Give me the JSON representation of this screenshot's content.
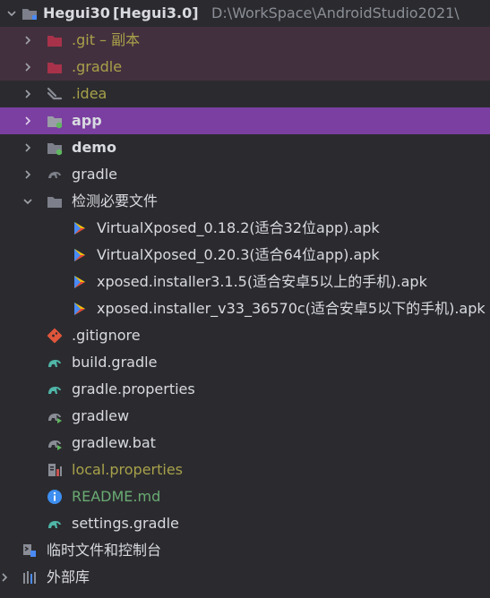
{
  "project": {
    "name": "Hegui30",
    "module": "[Hegui3.0]",
    "path": "D:\\WorkSpace\\AndroidStudio2021\\"
  },
  "items": [
    {
      "label": ".git – 副本",
      "icon": "folder-icon",
      "state": "ignored"
    },
    {
      "label": ".gradle",
      "icon": "folder-icon",
      "state": "ignored"
    },
    {
      "label": ".idea",
      "icon": "idea-folder-icon"
    },
    {
      "label": "app",
      "icon": "module-folder-icon",
      "state": "selected"
    },
    {
      "label": "demo",
      "icon": "module-folder-icon"
    },
    {
      "label": "gradle",
      "icon": "gradle-folder-icon"
    },
    {
      "label": "检测必要文件",
      "icon": "folder-icon",
      "state": "expanded"
    },
    {
      "label": "VirtualXposed_0.18.2(适合32位app).apk",
      "icon": "apk-icon"
    },
    {
      "label": "VirtualXposed_0.20.3(适合64位app).apk",
      "icon": "apk-icon"
    },
    {
      "label": "xposed.installer3.1.5(适合安卓5以上的手机).apk",
      "icon": "apk-icon"
    },
    {
      "label": "xposed.installer_v33_36570c(适合安卓5以下的手机).apk",
      "icon": "apk-icon"
    },
    {
      "label": ".gitignore",
      "icon": "gitignore-icon"
    },
    {
      "label": "build.gradle",
      "icon": "gradle-elephant-icon"
    },
    {
      "label": "gradle.properties",
      "icon": "gradle-elephant-icon"
    },
    {
      "label": "gradlew",
      "icon": "gradle-script-icon"
    },
    {
      "label": "gradlew.bat",
      "icon": "gradle-script-icon"
    },
    {
      "label": "local.properties",
      "icon": "properties-icon"
    },
    {
      "label": "README.md",
      "icon": "info-icon"
    },
    {
      "label": "settings.gradle",
      "icon": "gradle-elephant-icon"
    },
    {
      "label": "临时文件和控制台",
      "icon": "scratches-icon"
    },
    {
      "label": "外部库",
      "icon": "libraries-icon"
    }
  ],
  "colors": {
    "background": "#2b2b2f",
    "selected_row": "#7a3fa0",
    "ignored_row": "#43303e",
    "ignored_text": "#a8a14a",
    "info_text": "#56a8f5",
    "readme_text": "#6aab73"
  }
}
